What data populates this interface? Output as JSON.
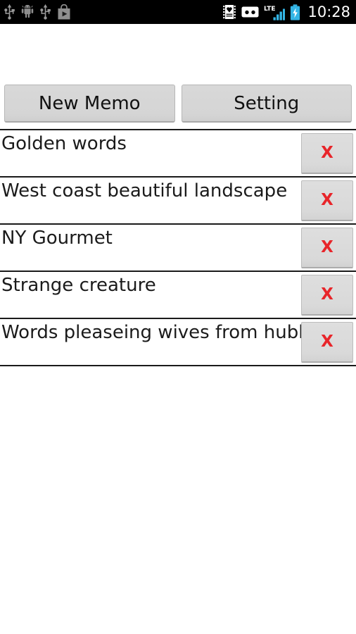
{
  "statusbar": {
    "time": "10:28",
    "left_icons": [
      {
        "name": "usb-icon",
        "label": "USB"
      },
      {
        "name": "android-debug-icon",
        "label": "Android"
      },
      {
        "name": "usb-icon",
        "label": "USB"
      },
      {
        "name": "play-store-icon",
        "label": "Play Store"
      }
    ],
    "right_icons": [
      {
        "name": "photo-frame-notification-icon",
        "label": "Photo"
      },
      {
        "name": "cassette-notification-icon",
        "label": "Cassette"
      },
      {
        "name": "lte-signal-icon",
        "label": "LTE"
      },
      {
        "name": "battery-charging-icon",
        "label": "Battery charging"
      }
    ],
    "network_label": "LTE",
    "signal_bars": 4,
    "colors": {
      "background": "#000000",
      "text": "#ffffff",
      "accent": "#33b5e5",
      "icon_gray": "#9a9a9a"
    }
  },
  "toolbar": {
    "new_memo_label": "New Memo",
    "setting_label": "Setting"
  },
  "memo_list": {
    "delete_label": "X",
    "delete_color": "#e8252a",
    "items": [
      {
        "title": "Golden words"
      },
      {
        "title": "West coast beautiful landscape"
      },
      {
        "title": "NY Gourmet"
      },
      {
        "title": "Strange creature"
      },
      {
        "title": "Words pleaseing wives from hubby"
      }
    ]
  }
}
